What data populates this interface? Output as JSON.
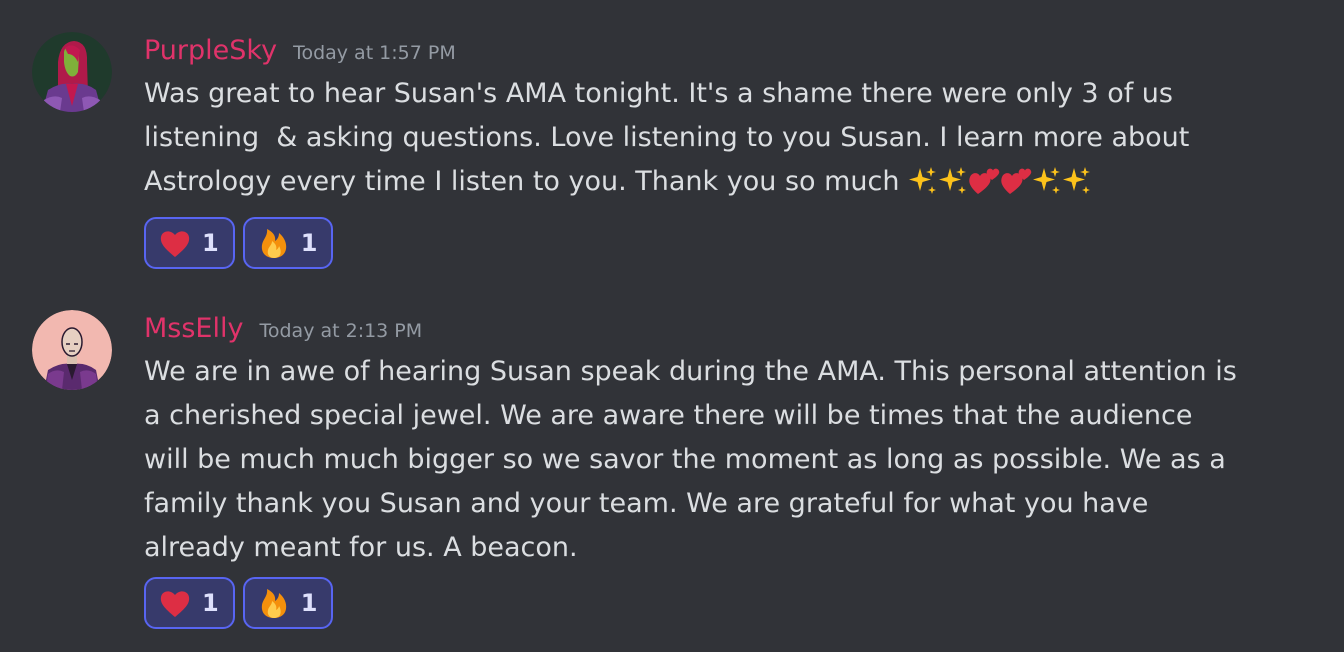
{
  "messages": [
    {
      "username": "PurpleSky",
      "timestamp": "Today at 1:57 PM",
      "text": "Was great to hear Susan's AMA tonight. It's a shame there were only 3 of us listening  & asking questions. Love listening to you Susan. I learn more about Astrology every time I listen to you. Thank you so much ",
      "trailing_emoji": [
        "sparkles-icon",
        "sparkles-icon",
        "two-hearts-icon",
        "two-hearts-icon",
        "sparkles-icon",
        "sparkles-icon"
      ],
      "reactions": [
        {
          "icon": "heart-icon",
          "count": "1"
        },
        {
          "icon": "fire-icon",
          "count": "1"
        }
      ]
    },
    {
      "username": "MssElly",
      "timestamp": "Today at 2:13 PM",
      "text": "We are in awe of hearing Susan speak during the AMA. This personal attention is a cherished special jewel. We are aware there will be times that the audience will be much much bigger so we savor the moment as long as possible. We as a family thank you Susan and your team. We are grateful for what you have already meant for us. A beacon.",
      "reactions": [
        {
          "icon": "heart-icon",
          "count": "1"
        },
        {
          "icon": "fire-icon",
          "count": "1"
        }
      ]
    }
  ],
  "colors": {
    "background": "#313338",
    "username": "#e0336a",
    "timestamp": "#949ba4",
    "text": "#dbdee1",
    "reaction_border": "#5865f2",
    "reaction_bg": "#373a6b"
  }
}
